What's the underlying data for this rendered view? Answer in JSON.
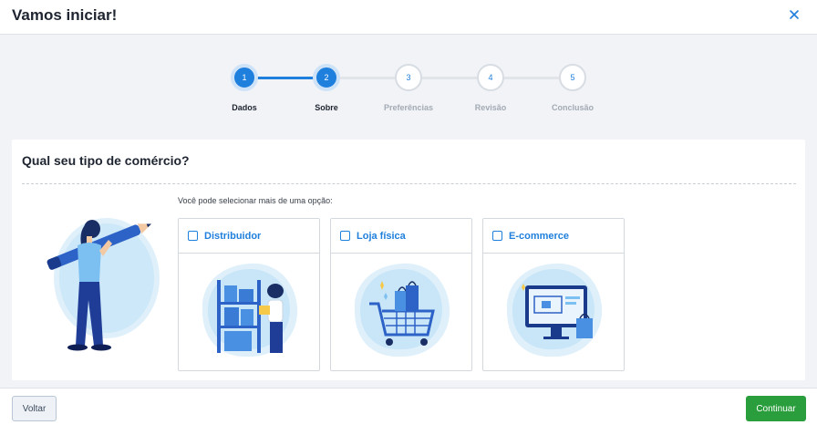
{
  "header": {
    "title": "Vamos iniciar!",
    "close_icon": "close-icon"
  },
  "stepper": {
    "current_step": 2,
    "steps": [
      {
        "number": "1",
        "label": "Dados"
      },
      {
        "number": "2",
        "label": "Sobre"
      },
      {
        "number": "3",
        "label": "Preferências"
      },
      {
        "number": "4",
        "label": "Revisão"
      },
      {
        "number": "5",
        "label": "Conclusão"
      }
    ]
  },
  "main": {
    "question": "Qual seu tipo de comércio?",
    "hint": "Você pode selecionar mais de uma opção:",
    "options": [
      {
        "label": "Distribuidor",
        "checked": false,
        "icon": "warehouse-illustration"
      },
      {
        "label": "Loja física",
        "checked": false,
        "icon": "shopping-cart-illustration"
      },
      {
        "label": "E-commerce",
        "checked": false,
        "icon": "online-store-illustration"
      }
    ]
  },
  "footer": {
    "back_label": "Voltar",
    "continue_label": "Continuar"
  },
  "colors": {
    "accent": "#1f7fdc",
    "success": "#2a9d3c",
    "accent_light": "#dff0fb"
  }
}
